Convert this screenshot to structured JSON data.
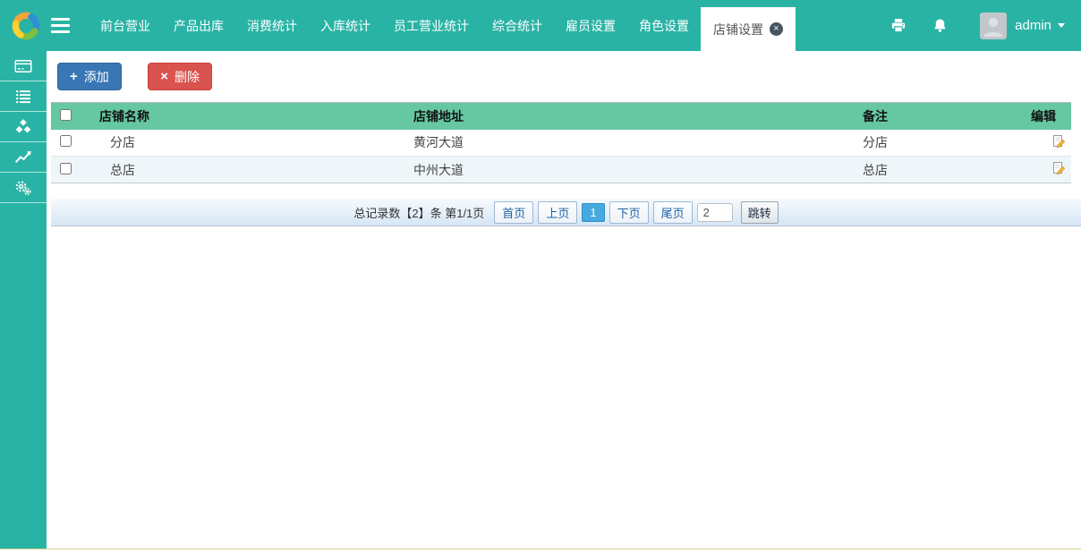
{
  "navbar": {
    "menu": [
      "前台营业",
      "产品出库",
      "消费统计",
      "入库统计",
      "员工营业统计",
      "综合统计",
      "雇员设置",
      "角色设置"
    ],
    "active_tab": {
      "label": "店铺设置",
      "close_glyph": "×"
    },
    "user": {
      "name": "admin"
    },
    "icons": [
      "printer-icon",
      "bell-icon",
      "avatar",
      "caret-down-icon"
    ]
  },
  "sidebar": {
    "items": [
      {
        "icon": "card-icon"
      },
      {
        "icon": "list-icon"
      },
      {
        "icon": "cubes-icon"
      },
      {
        "icon": "chart-line-icon"
      },
      {
        "icon": "gears-icon"
      }
    ]
  },
  "toolbar": {
    "add_label": "添加",
    "add_glyph": "+",
    "delete_label": "删除",
    "delete_glyph": "×"
  },
  "table": {
    "columns": {
      "name": "店铺名称",
      "address": "店铺地址",
      "remark": "备注",
      "edit": "编辑"
    },
    "rows": [
      {
        "name": "分店",
        "address": "黄河大道",
        "remark": "分店"
      },
      {
        "name": "总店",
        "address": "中州大道",
        "remark": "总店"
      }
    ]
  },
  "pagination": {
    "summary": "总记录数【2】条 第1/1页",
    "first": "首页",
    "prev": "上页",
    "current_page": "1",
    "next": "下页",
    "last": "尾页",
    "jump_value": "2",
    "jump_label": "跳转"
  },
  "colors": {
    "navbar_teal": "#29b3a5",
    "table_header_green": "#65c8a3",
    "add_button_blue": "#3876b4",
    "delete_button_red": "#d9534f",
    "pagination_current_blue": "#47a9de",
    "alt_row_blue": "#eff6fa"
  }
}
